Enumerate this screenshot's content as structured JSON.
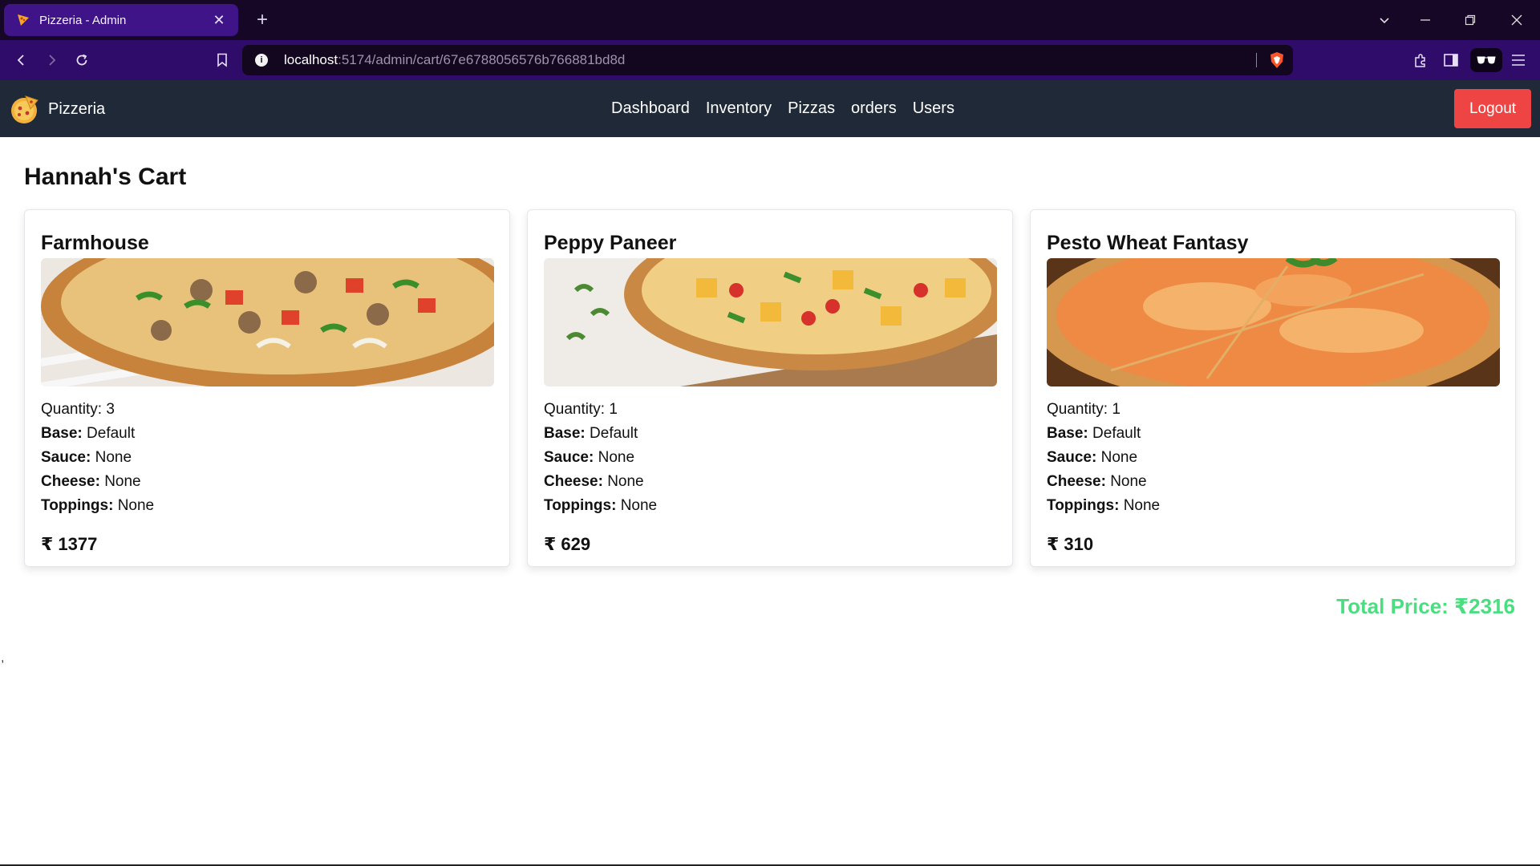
{
  "browser": {
    "tab_title": "Pizzeria - Admin",
    "tab_close": "✕",
    "new_tab": "+",
    "url_host": "localhost",
    "url_path": ":5174/admin/cart/67e6788056576b766881bd8d",
    "info_glyph": "i"
  },
  "navbar": {
    "brand": "Pizzeria",
    "links": [
      "Dashboard",
      "Inventory",
      "Pizzas",
      "orders",
      "Users"
    ],
    "logout": "Logout"
  },
  "page": {
    "title": "Hannah's Cart",
    "labels": {
      "quantity": "Quantity:",
      "base": "Base:",
      "sauce": "Sauce:",
      "cheese": "Cheese:",
      "toppings": "Toppings:"
    },
    "items": [
      {
        "name": "Farmhouse",
        "quantity": "3",
        "base": "Default",
        "sauce": "None",
        "cheese": "None",
        "toppings": "None",
        "price": "₹ 1377"
      },
      {
        "name": "Peppy Paneer",
        "quantity": "1",
        "base": "Default",
        "sauce": "None",
        "cheese": "None",
        "toppings": "None",
        "price": "₹ 629"
      },
      {
        "name": "Pesto Wheat Fantasy",
        "quantity": "1",
        "base": "Default",
        "sauce": "None",
        "cheese": "None",
        "toppings": "None",
        "price": "₹ 310"
      }
    ],
    "total": "Total Price: ₹2316",
    "stray_mark": ","
  },
  "colors": {
    "titlebar": "#150725",
    "toolbar": "#300c6a",
    "navbar": "#1f2937",
    "logout": "#ef4444",
    "total": "#4ade80"
  }
}
